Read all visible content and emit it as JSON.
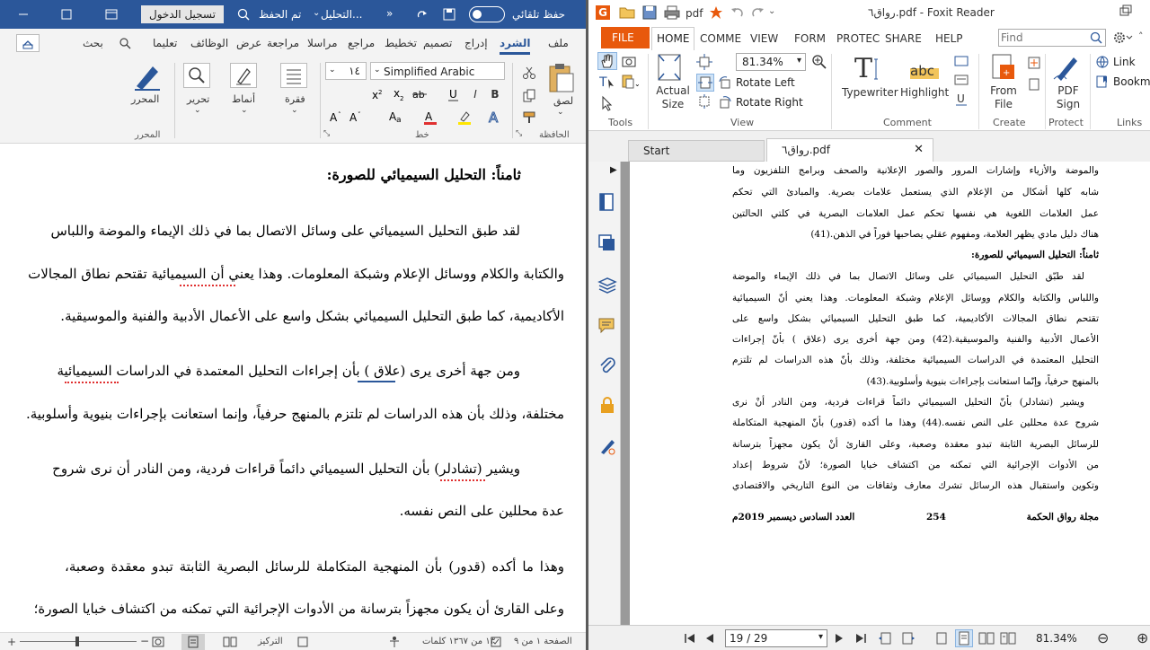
{
  "word": {
    "title": {
      "autosave_label": "حفظ تلقائي",
      "doc_name": "التحليل...",
      "save_state": "تم الحفظ",
      "login_button": "تسجيل الدخول"
    },
    "tabs": [
      "ملف",
      "الشرد",
      "إدراج",
      "تصميم",
      "تخطيط",
      "مراجع",
      "مراسلا",
      "مراجعة",
      "عرض",
      "الوظائف",
      "تعليما",
      "بحث"
    ],
    "ribbon": {
      "font_name": "Simplified Arabic",
      "font_size": "١٤",
      "paste": "لصق",
      "paragraph": "فقرة",
      "styles": "أنماط",
      "editing": "تحرير",
      "editor": "المحرر",
      "groups": {
        "clipboard": "الحافظة",
        "font": "خط",
        "paragraph": "فقرة",
        "styles": "أنماط",
        "editor": "المحرر"
      }
    },
    "doc": {
      "heading": "ثامناً: التحليل السيميائي للصورة:",
      "p1": [
        "لقد طبق التحليل السيميائي على وسائل الاتصال بما في ذلك الإيماء والموضة واللباس",
        "والكتابة والكلام ووسائل الإعلام وشبكة المعلومات. وهذا يعني أن السيميائية تقتحم نطاق المجالات",
        "الأكاديمية، كما طبق التحليل السيميائي بشكل واسع على الأعمال الأدبية والفنية والموسيقية."
      ],
      "p2": [
        "ومن جهة أخرى يرى (علاق ) بأن إجراءات التحليل المعتمدة في الدراسات السيميائية",
        "مختلفة، وذلك بأن هذه الدراسات لم تلتزم بالمنهج حرفياً، وإنما استعانت بإجراءات بنيوية وأسلوبية."
      ],
      "p3": [
        "ويشير (تشادلر) بأن التحليل السيميائي دائماً قراءات فردية، ومن النادر أن نرى شروح",
        "عدة محللين على النص نفسه."
      ],
      "p4": [
        "وهذا ما أكده (قدور) بأن المنهجية المتكاملة للرسائل البصرية الثابتة تبدو معقدة وصعبة،",
        "وعلى القارئ أن يكون مجهزاً بترسانة من الأدوات الإجرائية التي تمكنه من اكتشاف خبايا الصورة؛"
      ]
    },
    "status": {
      "page": "الصفحة ١ من ٩",
      "words": "١٣ من ١٣٦٧ كلمات",
      "focus": "التركيز"
    }
  },
  "foxit": {
    "title": "رواق٦.pdf - Foxit Reader",
    "tabs": [
      "FILE",
      "HOME",
      "COMME",
      "VIEW",
      "FORM",
      "PROTEC",
      "SHARE",
      "HELP"
    ],
    "search_placeholder": "Find",
    "ribbon": {
      "actual_size": "Actual Size",
      "zoom": "81.34%",
      "rotate_left": "Rotate Left",
      "rotate_right": "Rotate Right",
      "typewriter": "Typewriter",
      "highlight": "Highlight",
      "from_file": "From File",
      "pdf_sign": "PDF Sign",
      "link": "Link",
      "bookmark": "Bookma",
      "groups": {
        "tools": "Tools",
        "view": "View",
        "comment": "Comment",
        "create": "Create",
        "protect": "Protect",
        "links": "Links"
      }
    },
    "doc_tabs": {
      "start": "Start",
      "file": "رواق٦.pdf"
    },
    "page": {
      "lines_top": [
        "والموضة والأزياء وإشارات المرور والصور الإعلانية والصحف وبرامج التلفزيون وما",
        "شابه كلها أشكال من الإعلام الذي يستعمل علامات بصرية. والمبادئ التي تحكم",
        "عمل العلامات اللغوية هي نفسها تحكم عمل العلامات البصرية في كلتي الحالتين",
        "هناك دليل مادي يظهر العلامة، ومفهوم عقلي يصاحبها فوراً في الذهن.(41)"
      ],
      "heading": "ثامناً: التحليل السيميائي للصورة:",
      "lines_body": [
        "لقد طبّق التحليل السيميائي على وسائل الاتصال بما في ذلك الإيماء والموضة",
        "واللباس والكتابة والكلام ووسائل الإعلام وشبكة المعلومات. وهذا يعني أنّ السيميائية",
        "تقتحم نطاق المجالات الأكاديمية، كما طبق التحليل السيميائي بشكل واسع على",
        "الأعمال الأدبية والفنية والموسيقية.(42) ومن جهة أخرى يرى (علاق ) بأنّ إجراءات",
        "التحليل المعتمدة في الدراسات السيميائية مختلفة، وذلك بأنّ هذه الدراسات لم تلتزم",
        "بالمنهج حرفياً، وإنّما استعانت بإجراءات  بنيوية وأسلوبية.(43)",
        "ويشير (تشادلر) بأنّ التحليل السيميائي دائماً قراءات فردية، ومن النادر أنْ نرى",
        "شروح عدة محللين على النص نفسه.(44) وهذا ما أكده (قدور) بأنّ المنهجية المتكاملة",
        "للرسائل البصرية الثابتة تبدو معقدة وصعبة، وعلى القارئ أنْ يكون مجهزاً بترسانة",
        "من الأدوات الإجرائية التي تمكنه من اكتشاف خبايا الصورة؛ لأنّ شروط إعداد",
        "وتكوين واستقبال هذه الرسائل تشرك معارف وثقافات من النوع التاريخي والاقتصادي"
      ],
      "footer": {
        "journal": "مجلة رواق الحكمة",
        "page_num": "254",
        "issue": "العدد السادس ديسمبر 2019م"
      }
    },
    "status": {
      "page_field": "19 / 29",
      "zoom": "81.34%"
    }
  }
}
